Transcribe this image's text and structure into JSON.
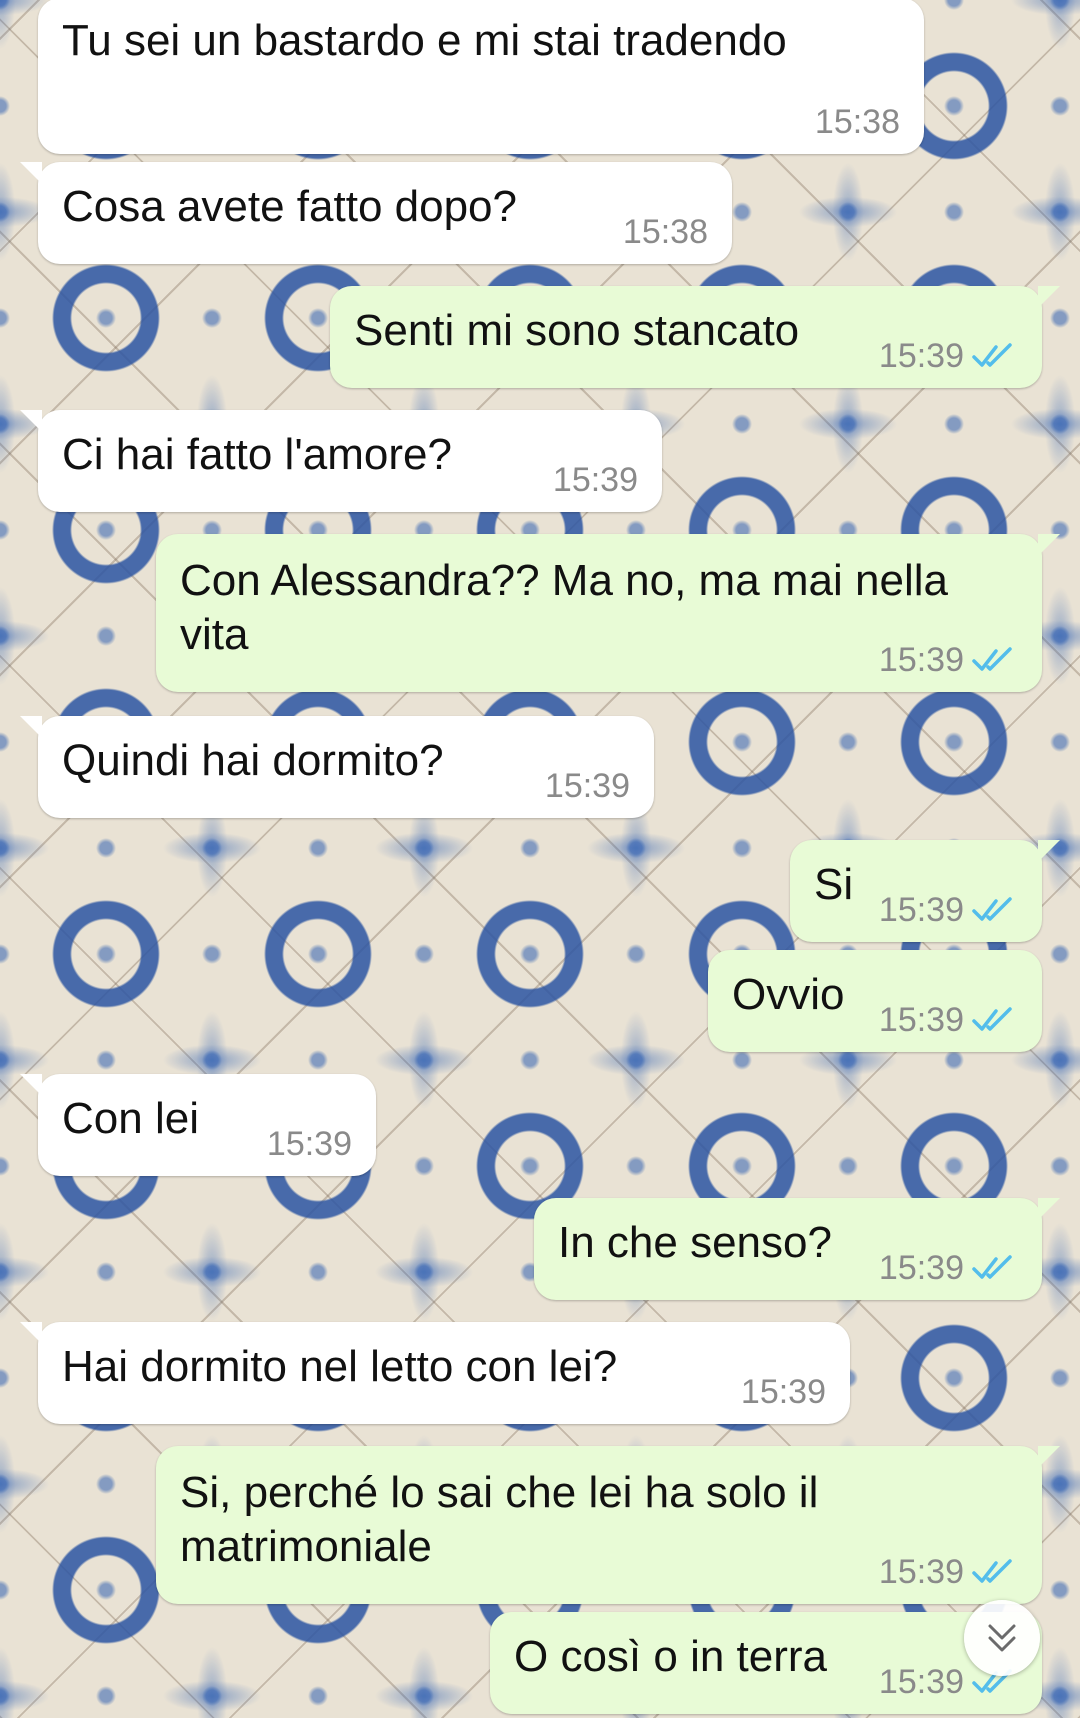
{
  "messages": [
    {
      "dir": "in",
      "text": "Tu sei un bastardo e mi stai tradendo",
      "time": "15:38"
    },
    {
      "dir": "in",
      "text": "Cosa avete fatto dopo?",
      "time": "15:38"
    },
    {
      "dir": "out",
      "text": "Senti mi sono stancato",
      "time": "15:39",
      "status": "read"
    },
    {
      "dir": "in",
      "text": "Ci hai fatto l'amore?",
      "time": "15:39"
    },
    {
      "dir": "out",
      "text": "Con Alessandra?? Ma no, ma mai nella vita",
      "time": "15:39",
      "status": "read"
    },
    {
      "dir": "in",
      "text": "Quindi hai dormito?",
      "time": "15:39"
    },
    {
      "dir": "out",
      "text": "Si",
      "time": "15:39",
      "status": "read"
    },
    {
      "dir": "out",
      "text": "Ovvio",
      "time": "15:39",
      "status": "read"
    },
    {
      "dir": "in",
      "text": "Con lei",
      "time": "15:39"
    },
    {
      "dir": "out",
      "text": "In che senso?",
      "time": "15:39",
      "status": "read"
    },
    {
      "dir": "in",
      "text": "Hai dormito nel letto con lei?",
      "time": "15:39"
    },
    {
      "dir": "out",
      "text": "Si, perché lo sai che lei ha solo il matrimoniale",
      "time": "15:39",
      "status": "read"
    },
    {
      "dir": "out",
      "text": "O così o in terra",
      "time": "15:39",
      "status": "read"
    }
  ],
  "colors": {
    "incoming": "#ffffff",
    "outgoing": "#e8fbd6",
    "read_tick": "#53bdeb"
  },
  "icons": {
    "read": "double-check-icon",
    "scroll": "chevron-double-down-icon"
  }
}
